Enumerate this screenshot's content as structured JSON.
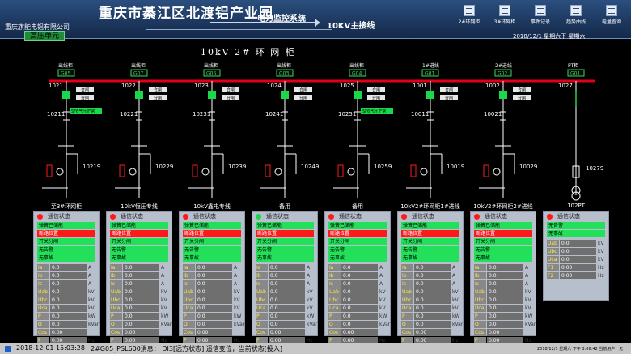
{
  "header": {
    "company": "重庆旗能电铝有限公司",
    "title": "重庆市綦江区北渡铝产业园",
    "system": "电力监控系统",
    "page": "10KV主接线",
    "datetime": "2018/12/1 星期六下 星期六",
    "nav": [
      {
        "label": "2#环网柜",
        "icon": "cabinet-icon"
      },
      {
        "label": "3#环网柜",
        "icon": "cabinet-icon"
      },
      {
        "label": "事件记录",
        "icon": "event-log-icon"
      },
      {
        "label": "趋势曲线",
        "icon": "trend-icon"
      },
      {
        "label": "电量查询",
        "icon": "energy-query-icon"
      }
    ]
  },
  "unit_tab": "高压单元",
  "diagram_title": "10kV 2# 环 网 柜",
  "bays": [
    {
      "cab": "出线柜",
      "code": "G05",
      "sw": "1021",
      "earth": "10211",
      "ground": "10219",
      "label": "至3#环网柜",
      "live": true,
      "pressure": "SF6气压正常"
    },
    {
      "cab": "出线柜",
      "code": "G07",
      "sw": "1022",
      "earth": "10221",
      "ground": "10229",
      "label": "10kV恒压专线",
      "live": true,
      "pressure": ""
    },
    {
      "cab": "出线柜",
      "code": "G06",
      "sw": "1023",
      "earth": "10231",
      "ground": "10239",
      "label": "10kV鑫电专线",
      "live": true,
      "pressure": ""
    },
    {
      "cab": "出线柜",
      "code": "G03",
      "sw": "1024",
      "earth": "10241",
      "ground": "10249",
      "label": "备用",
      "live": false,
      "pressure": ""
    },
    {
      "cab": "出线柜",
      "code": "G04",
      "sw": "1025",
      "earth": "10251",
      "ground": "10259",
      "label": "备用",
      "live": true,
      "pressure": "SF6气压正常"
    },
    {
      "cab": "1#进线",
      "code": "G01",
      "sw": "1001",
      "earth": "10011",
      "ground": "10019",
      "label": "10kV2#环网柜1#进线",
      "live": true,
      "pressure": ""
    },
    {
      "cab": "2#进线",
      "code": "G02",
      "sw": "1002",
      "earth": "10021",
      "ground": "10029",
      "label": "10kV2#环网柜2#进线",
      "live": true,
      "pressure": ""
    },
    {
      "cab": "PT柜",
      "code": "G01",
      "sw": "1027",
      "earth": "",
      "ground": "10279",
      "label": "102PT",
      "live": false,
      "pressure": ""
    }
  ],
  "closing_labels": {
    "close": "合闸",
    "open": "分闸"
  },
  "panels": [
    {
      "comm": "通信状态",
      "comm_ok": false,
      "states": [
        {
          "t": "弹簧已储能",
          "c": "green"
        },
        {
          "t": "断路位置",
          "c": "red"
        },
        {
          "t": "开关分闸",
          "c": "green"
        },
        {
          "t": "无告警",
          "c": "green"
        },
        {
          "t": "无事故",
          "c": "green"
        }
      ]
    },
    {
      "comm": "通信状态",
      "comm_ok": false,
      "states": [
        {
          "t": "弹簧已储能",
          "c": "green"
        },
        {
          "t": "断路位置",
          "c": "red"
        },
        {
          "t": "开关分闸",
          "c": "green"
        },
        {
          "t": "无告警",
          "c": "green"
        },
        {
          "t": "无事故",
          "c": "green"
        }
      ]
    },
    {
      "comm": "通信状态",
      "comm_ok": false,
      "states": [
        {
          "t": "弹簧已储能",
          "c": "green"
        },
        {
          "t": "断路位置",
          "c": "red"
        },
        {
          "t": "开关分闸",
          "c": "green"
        },
        {
          "t": "无告警",
          "c": "green"
        },
        {
          "t": "无事故",
          "c": "green"
        }
      ]
    },
    {
      "comm": "通信状态",
      "comm_ok": true,
      "states": [
        {
          "t": "弹簧已储能",
          "c": "green"
        },
        {
          "t": "断路位置",
          "c": "red"
        },
        {
          "t": "开关分闸",
          "c": "green"
        },
        {
          "t": "无告警",
          "c": "green"
        },
        {
          "t": "无事故",
          "c": "green"
        }
      ]
    },
    {
      "comm": "通信状态",
      "comm_ok": false,
      "states": [
        {
          "t": "弹簧已储能",
          "c": "green"
        },
        {
          "t": "断路位置",
          "c": "red"
        },
        {
          "t": "开关分闸",
          "c": "green"
        },
        {
          "t": "无告警",
          "c": "green"
        },
        {
          "t": "无事故",
          "c": "green"
        }
      ]
    },
    {
      "comm": "通信状态",
      "comm_ok": false,
      "states": [
        {
          "t": "弹簧已储能",
          "c": "green"
        },
        {
          "t": "断路位置",
          "c": "red"
        },
        {
          "t": "开关分闸",
          "c": "green"
        },
        {
          "t": "无告警",
          "c": "green"
        },
        {
          "t": "无事故",
          "c": "green"
        }
      ]
    },
    {
      "comm": "通信状态",
      "comm_ok": false,
      "states": [
        {
          "t": "弹簧已储能",
          "c": "green"
        },
        {
          "t": "断路位置",
          "c": "red"
        },
        {
          "t": "开关分闸",
          "c": "green"
        },
        {
          "t": "无告警",
          "c": "green"
        },
        {
          "t": "无事故",
          "c": "green"
        }
      ]
    },
    {
      "comm": "通信状态",
      "comm_ok": false,
      "states": [
        {
          "t": "无告警",
          "c": "green"
        },
        {
          "t": "无事故",
          "c": "green"
        }
      ]
    }
  ],
  "measurements": [
    {
      "n": "Ia",
      "v": "0.0",
      "u": "A"
    },
    {
      "n": "Ib",
      "v": "0.0",
      "u": "A"
    },
    {
      "n": "Ic",
      "v": "0.0",
      "u": "A"
    },
    {
      "n": "Uab",
      "v": "0.0",
      "u": "kV"
    },
    {
      "n": "Ubc",
      "v": "0.0",
      "u": "kV"
    },
    {
      "n": "Uca",
      "v": "0.0",
      "u": "kV"
    },
    {
      "n": "P",
      "v": "0.0",
      "u": "kW"
    },
    {
      "n": "Q",
      "v": "0.0",
      "u": "kVar"
    },
    {
      "n": "Cos",
      "v": "0.00",
      "u": ""
    },
    {
      "n": "F",
      "v": "0.00",
      "u": "Hz"
    }
  ],
  "pt_measurements": [
    {
      "n": "Uab",
      "v": "0.0",
      "u": "kV"
    },
    {
      "n": "Ubc",
      "v": "0.0",
      "u": "kV"
    },
    {
      "n": "Uca",
      "v": "0.0",
      "u": "kV"
    },
    {
      "n": "F1",
      "v": "0.00",
      "u": "Hz"
    },
    {
      "n": "F2",
      "v": "0.00",
      "u": "Hz"
    }
  ],
  "status": {
    "time": "2018-12-01 15:03:28",
    "message": "2#G05_PSL600消息： DI3[远方状态] 遥信变位，当前状态[投入]",
    "right": "2018/12/1 星期六 下午 3:06:42  当前用户：无"
  },
  "colors": {
    "busbar": "#e0001a",
    "line": "#ffffff",
    "closed": "#19d94a",
    "alarm": "#ff1a1a"
  }
}
